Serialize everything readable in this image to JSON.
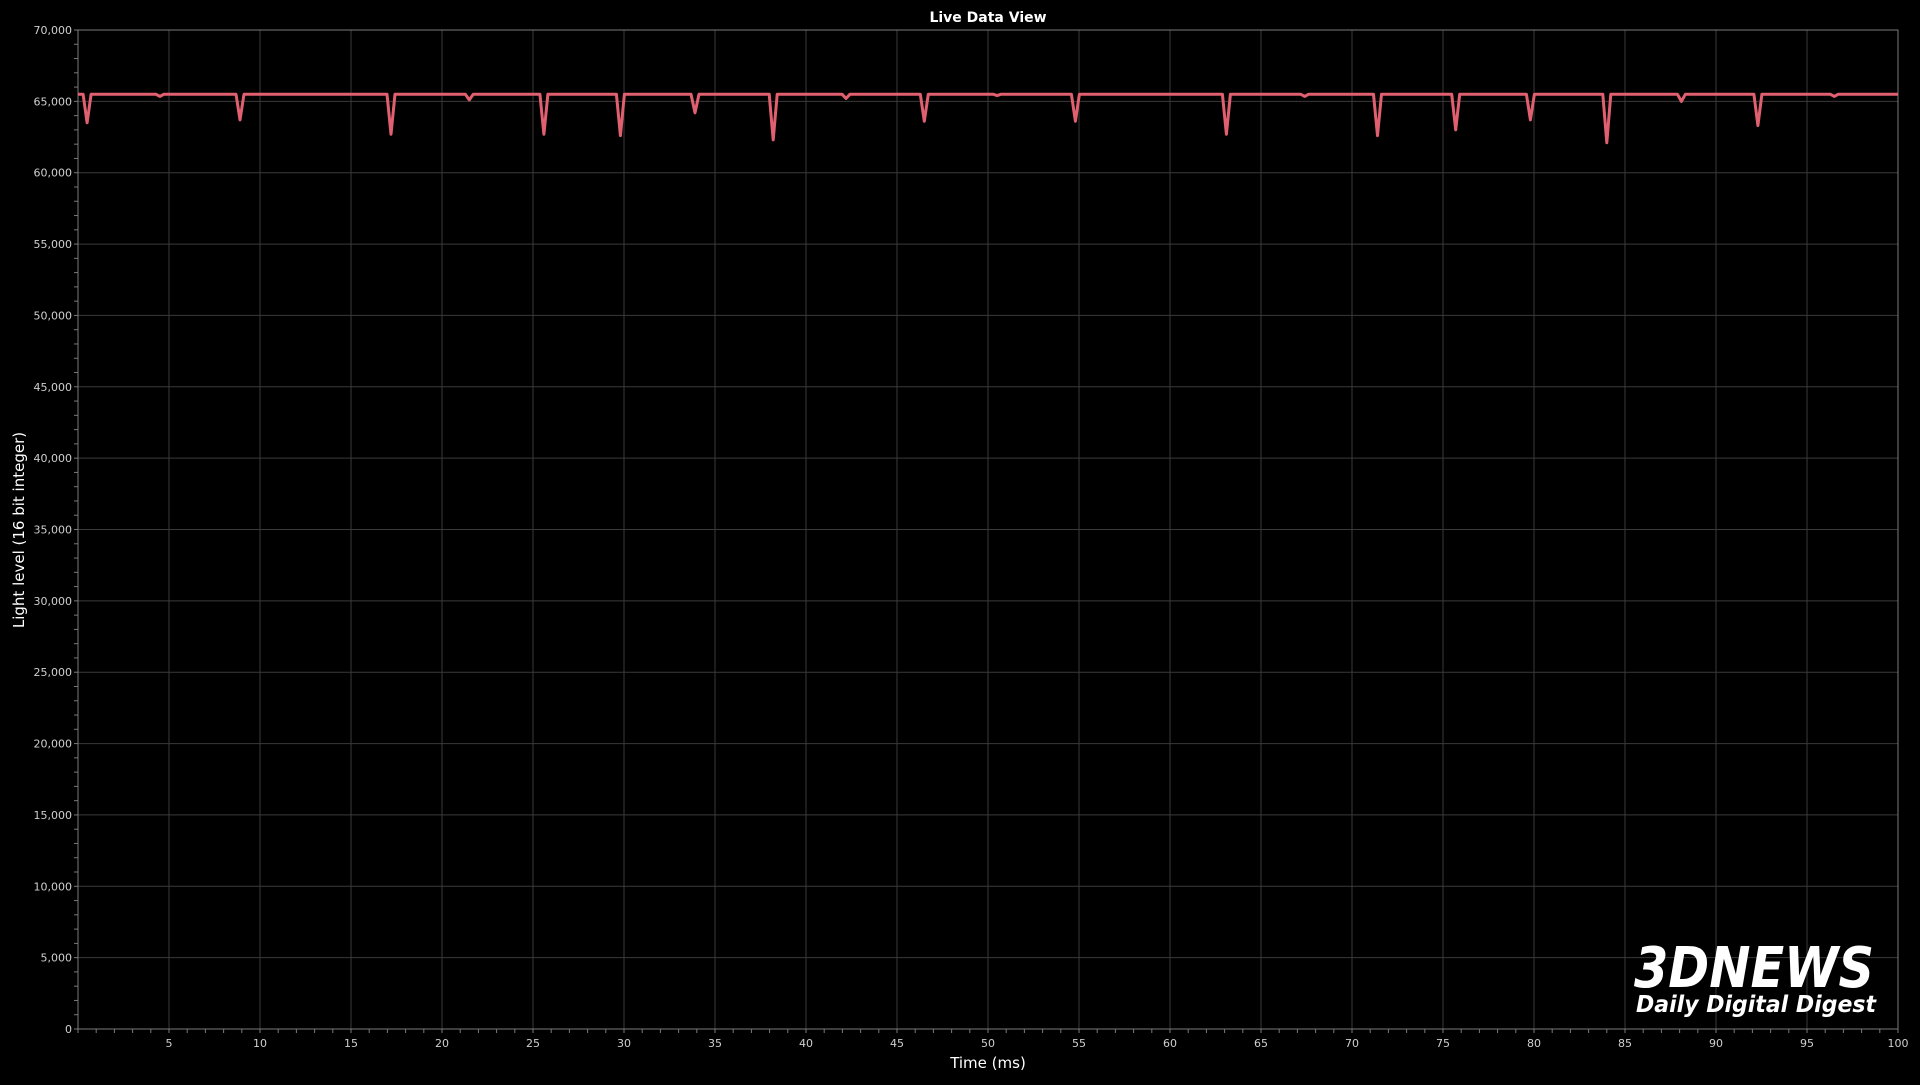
{
  "chart_data": {
    "type": "line",
    "title": "Live Data View",
    "xlabel": "Time (ms)",
    "ylabel": "Light level (16 bit integer)",
    "xlim": [
      0,
      100
    ],
    "ylim": [
      0,
      70000
    ],
    "x_ticks": [
      5,
      10,
      15,
      20,
      25,
      30,
      35,
      40,
      45,
      50,
      55,
      60,
      65,
      70,
      75,
      80,
      85,
      90,
      95,
      100
    ],
    "x_tick_labels": [
      "5",
      "10",
      "15",
      "20",
      "25",
      "30",
      "35",
      "40",
      "45",
      "50",
      "55",
      "60",
      "65",
      "70",
      "75",
      "80",
      "85",
      "90",
      "95",
      "100"
    ],
    "y_ticks": [
      0,
      5000,
      10000,
      15000,
      20000,
      25000,
      30000,
      35000,
      40000,
      45000,
      50000,
      55000,
      60000,
      65000,
      70000
    ],
    "y_tick_labels": [
      "0",
      "5,000",
      "10,000",
      "15,000",
      "20,000",
      "25,000",
      "30,000",
      "35,000",
      "40,000",
      "45,000",
      "50,000",
      "55,000",
      "60,000",
      "65,000",
      "70,000"
    ],
    "grid": true,
    "series": [
      {
        "color": "#e06070",
        "baseline": 65500,
        "dips": [
          {
            "x": 0.5,
            "y": 63500
          },
          {
            "x": 4.5,
            "y": 65350
          },
          {
            "x": 8.9,
            "y": 63700
          },
          {
            "x": 17.2,
            "y": 62700
          },
          {
            "x": 21.5,
            "y": 65100
          },
          {
            "x": 25.6,
            "y": 62700
          },
          {
            "x": 29.8,
            "y": 62600
          },
          {
            "x": 33.9,
            "y": 64200
          },
          {
            "x": 38.2,
            "y": 62300
          },
          {
            "x": 42.2,
            "y": 65200
          },
          {
            "x": 46.5,
            "y": 63600
          },
          {
            "x": 50.5,
            "y": 65400
          },
          {
            "x": 54.8,
            "y": 63600
          },
          {
            "x": 63.1,
            "y": 62700
          },
          {
            "x": 67.4,
            "y": 65350
          },
          {
            "x": 71.4,
            "y": 62600
          },
          {
            "x": 75.7,
            "y": 63000
          },
          {
            "x": 79.8,
            "y": 63700
          },
          {
            "x": 84.0,
            "y": 62100
          },
          {
            "x": 88.1,
            "y": 65000
          },
          {
            "x": 92.3,
            "y": 63300
          },
          {
            "x": 96.5,
            "y": 65350
          }
        ]
      }
    ]
  },
  "watermark": {
    "brand": "3DNEWS",
    "tagline": "Daily Digital Digest"
  }
}
